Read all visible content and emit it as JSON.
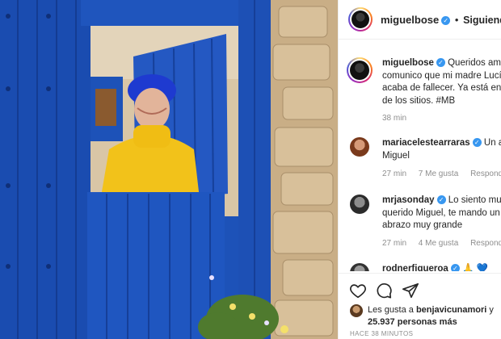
{
  "post": {
    "image_alt": "Woman in yellow turtleneck leaning over a blue wooden door",
    "header": {
      "username": "miguelbose",
      "separator": "•",
      "follow_status": "Siguiendo"
    },
    "caption": {
      "username": "miguelbose",
      "text_lines": [
        "Queridos amig",
        "comunico que mi madre Lucí",
        "acaba de fallecer. Ya está en e",
        "de los sitios. #MB"
      ],
      "time": "38 min"
    },
    "comments": [
      {
        "username": "mariacelestearraras",
        "text_lines": [
          "Un ab",
          "Miguel"
        ],
        "time": "27 min",
        "likes": "7 Me gusta",
        "reply": "Responder"
      },
      {
        "username": "mrjasonday",
        "text_lines": [
          "Lo siento muc",
          "querido Miguel, te mando un",
          "abrazo muy grande"
        ],
        "time": "27 min",
        "likes": "4 Me gusta",
        "reply": "Responder"
      },
      {
        "username": "rodnerfigueroa",
        "text_lines": [
          "🙏 💙"
        ]
      }
    ],
    "actions": {
      "like_icon": "heart-icon",
      "comment_icon": "comment-icon",
      "share_icon": "share-icon"
    },
    "likes": {
      "prefix": "Les gusta a",
      "user": "benjavicunamori",
      "conj": "y",
      "count": "25.937",
      "suffix": "personas más"
    },
    "timestamp": "HACE 38 MINUTOS"
  },
  "colors": {
    "verified": "#3897f0",
    "door_blue": "#1b4fb4",
    "sweater": "#f2c21a"
  }
}
